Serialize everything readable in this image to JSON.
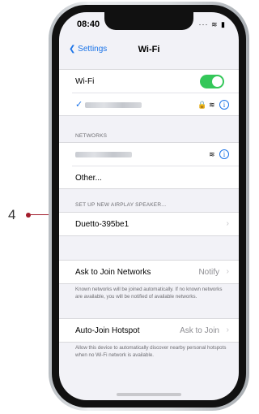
{
  "callout": {
    "number": "4"
  },
  "status": {
    "time": "08:40",
    "icons": "···  ≋ ▮"
  },
  "nav": {
    "back_label": "Settings",
    "title": "Wi-Fi"
  },
  "wifi": {
    "label": "Wi-Fi",
    "toggle_on": true,
    "connected_icons": "🔒 ≋"
  },
  "networks": {
    "header": "NETWORKS",
    "other_label": "Other..."
  },
  "airplay": {
    "header": "SET UP NEW AIRPLAY SPEAKER...",
    "speaker_name": "Duetto-395be1"
  },
  "ask_join": {
    "label": "Ask to Join Networks",
    "value": "Notify",
    "footer": "Known networks will be joined automatically. If no known networks are available, you will be notified of available networks."
  },
  "auto_hotspot": {
    "label": "Auto-Join Hotspot",
    "value": "Ask to Join",
    "footer": "Allow this device to automatically discover nearby personal hotspots when no Wi-Fi network is available."
  },
  "icons": {
    "back": "chevron-left-icon",
    "check": "checkmark-icon",
    "info": "info-icon",
    "chevron": "chevron-right-icon"
  },
  "colors": {
    "accent": "#1a73e8",
    "toggle": "#34c759",
    "callout": "#a21c2b"
  }
}
